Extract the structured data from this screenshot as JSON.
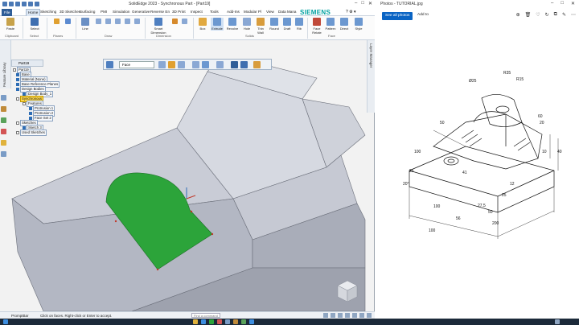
{
  "solidedge": {
    "title": "SolidEdge 2023 - Synchronous Part - [Part19]",
    "tabs": [
      "File",
      "Home",
      "Sketching",
      "3D Sketches",
      "Surfacing",
      "PMI",
      "Simulation",
      "Generative",
      "Reverse En",
      "3D Print",
      "Inspect",
      "Tools",
      "Add-Ins",
      "Modular Pl",
      "View",
      "Data Mana"
    ],
    "brand": "SIEMENS",
    "ribbon": {
      "buttons": [
        "Paste",
        "Select",
        "Line",
        "Smart Dimension",
        "Box",
        "Extrude",
        "Revolve",
        "Hole",
        "Thin Wall",
        "Round",
        "Draft",
        "Rib",
        "Pattern",
        "Mirror",
        "Face Relate",
        "Move",
        "Direct",
        "Style"
      ],
      "groups": [
        "Clipboard",
        "Select",
        "Planes",
        "Draw",
        "Solids",
        "Dimension",
        "Pattern",
        "Face"
      ]
    },
    "doc_tab": "Part19",
    "pathfinder_label": "Feature Library",
    "right_strip_label": "Layer Manager",
    "tree": [
      {
        "label": "Part19",
        "level": 0,
        "selected": false
      },
      {
        "label": "Base",
        "level": 1,
        "selected": false
      },
      {
        "label": "Material (None)",
        "level": 1,
        "selected": false
      },
      {
        "label": "Base Reference Planes",
        "level": 1,
        "selected": false
      },
      {
        "label": "Design Bodies",
        "level": 1,
        "selected": false
      },
      {
        "label": "Design Body_1",
        "level": 2,
        "selected": false
      },
      {
        "label": "Synchronous",
        "level": 1,
        "selected": true
      },
      {
        "label": "Features",
        "level": 2,
        "selected": false
      },
      {
        "label": "Protrusion 1",
        "level": 3,
        "selected": false
      },
      {
        "label": "Protrusion 2",
        "level": 3,
        "selected": false
      },
      {
        "label": "Face Set 2",
        "level": 3,
        "selected": false
      },
      {
        "label": "Sketches",
        "level": 1,
        "selected": false
      },
      {
        "label": "Sketch 3",
        "level": 2,
        "selected": false
      },
      {
        "label": "Used Sketches",
        "level": 1,
        "selected": false
      }
    ],
    "command_bar": {
      "select_value": "Face"
    },
    "status": {
      "prompt_label": "PromptBar",
      "message": "Click on faces. Right-click or Enter to accept.",
      "find_placeholder": "Find a command"
    },
    "colors": {
      "selected_face": "#2ca43a",
      "body": "#c3c7d2",
      "accent": "#2e5d97"
    }
  },
  "photos": {
    "title": "Photos - TUTORIAL.jpg",
    "all_photos": "See all photos",
    "add_to": "Add to",
    "drawing_dims": [
      "R35",
      "R15",
      "Ø25",
      "50",
      "60",
      "10",
      "40",
      "100",
      "25",
      "20°",
      "41",
      "12",
      "25",
      "27.5",
      "50",
      "100",
      "56",
      "200",
      "100",
      "20"
    ]
  }
}
